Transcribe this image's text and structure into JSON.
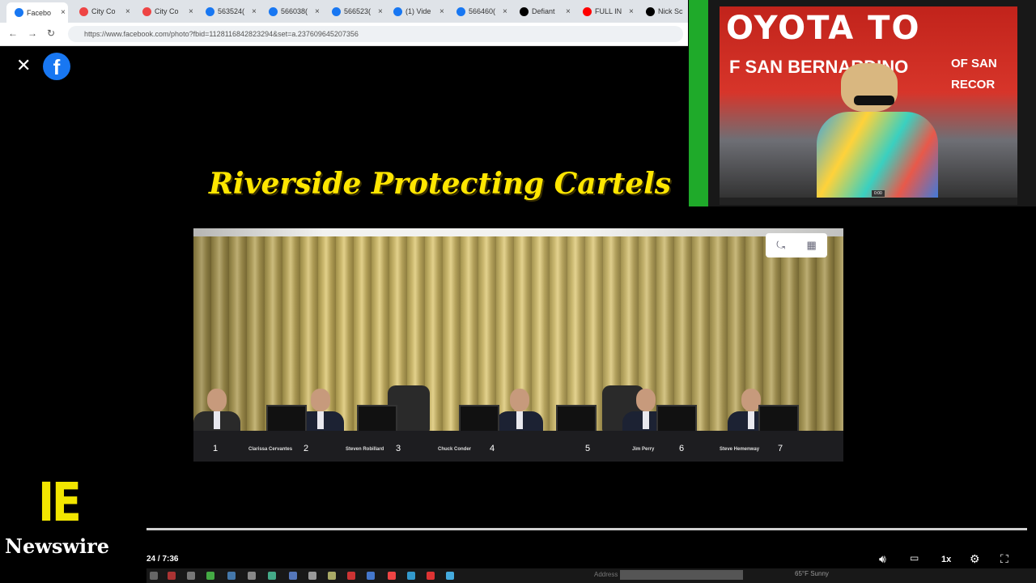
{
  "browser": {
    "tabs": [
      {
        "title": "Facebo",
        "icon": "facebook-icon",
        "color": "#1877f2",
        "active": true
      },
      {
        "title": "City Co",
        "icon": "google-icon",
        "color": "#e44",
        "active": false
      },
      {
        "title": "City Co",
        "icon": "google-icon",
        "color": "#e44",
        "active": false
      },
      {
        "title": "563524(",
        "icon": "facebook-icon",
        "color": "#1877f2",
        "active": false
      },
      {
        "title": "566038(",
        "icon": "facebook-icon",
        "color": "#1877f2",
        "active": false
      },
      {
        "title": "566523(",
        "icon": "facebook-icon",
        "color": "#1877f2",
        "active": false
      },
      {
        "title": "(1) Vide",
        "icon": "facebook-icon",
        "color": "#1877f2",
        "active": false
      },
      {
        "title": "566460(",
        "icon": "facebook-icon",
        "color": "#1877f2",
        "active": false
      },
      {
        "title": "Defiant",
        "icon": "x-icon",
        "color": "#000000",
        "active": false
      },
      {
        "title": "FULL IN",
        "icon": "youtube-icon",
        "color": "#ff0000",
        "active": false
      },
      {
        "title": "Nick Sc",
        "icon": "x-icon",
        "color": "#000000",
        "active": false
      }
    ],
    "url": "https://www.facebook.com/photo?fbid=1128116842823294&set=a.237609645207356"
  },
  "overlay": {
    "close_glyph": "✕",
    "logo_letter": "f"
  },
  "headline": "Riverside Protecting Cartels",
  "video": {
    "seats": [
      {
        "num": "1",
        "name": ""
      },
      {
        "num": "2",
        "name": "Clarissa Cervantes"
      },
      {
        "num": "3",
        "name": "Steven Robillard"
      },
      {
        "num": "4",
        "name": "Chuck Conder"
      },
      {
        "num": "5",
        "name": ""
      },
      {
        "num": "6",
        "name": "Jim Perry"
      },
      {
        "num": "7",
        "name": "Steve Hemenway"
      }
    ]
  },
  "webcam": {
    "banner_line1": "OYOTA TO",
    "banner_line2": "F SAN BERNARDINO",
    "banner_right1": "OF SAN",
    "banner_right2": "RECOR",
    "time_label": "0:00"
  },
  "branding": {
    "ie": "IE",
    "newswire": "Newswire"
  },
  "player": {
    "progress": 1.0,
    "timecode": "24 / 7:36",
    "speed": "1x",
    "volume_icon": "volume-icon",
    "captions_icon": "captions-icon",
    "settings_icon": "settings-icon",
    "fullscreen_icon": "fullscreen-icon"
  },
  "taskbar": {
    "address_label": "Address",
    "weather": "65°F Sunny"
  }
}
